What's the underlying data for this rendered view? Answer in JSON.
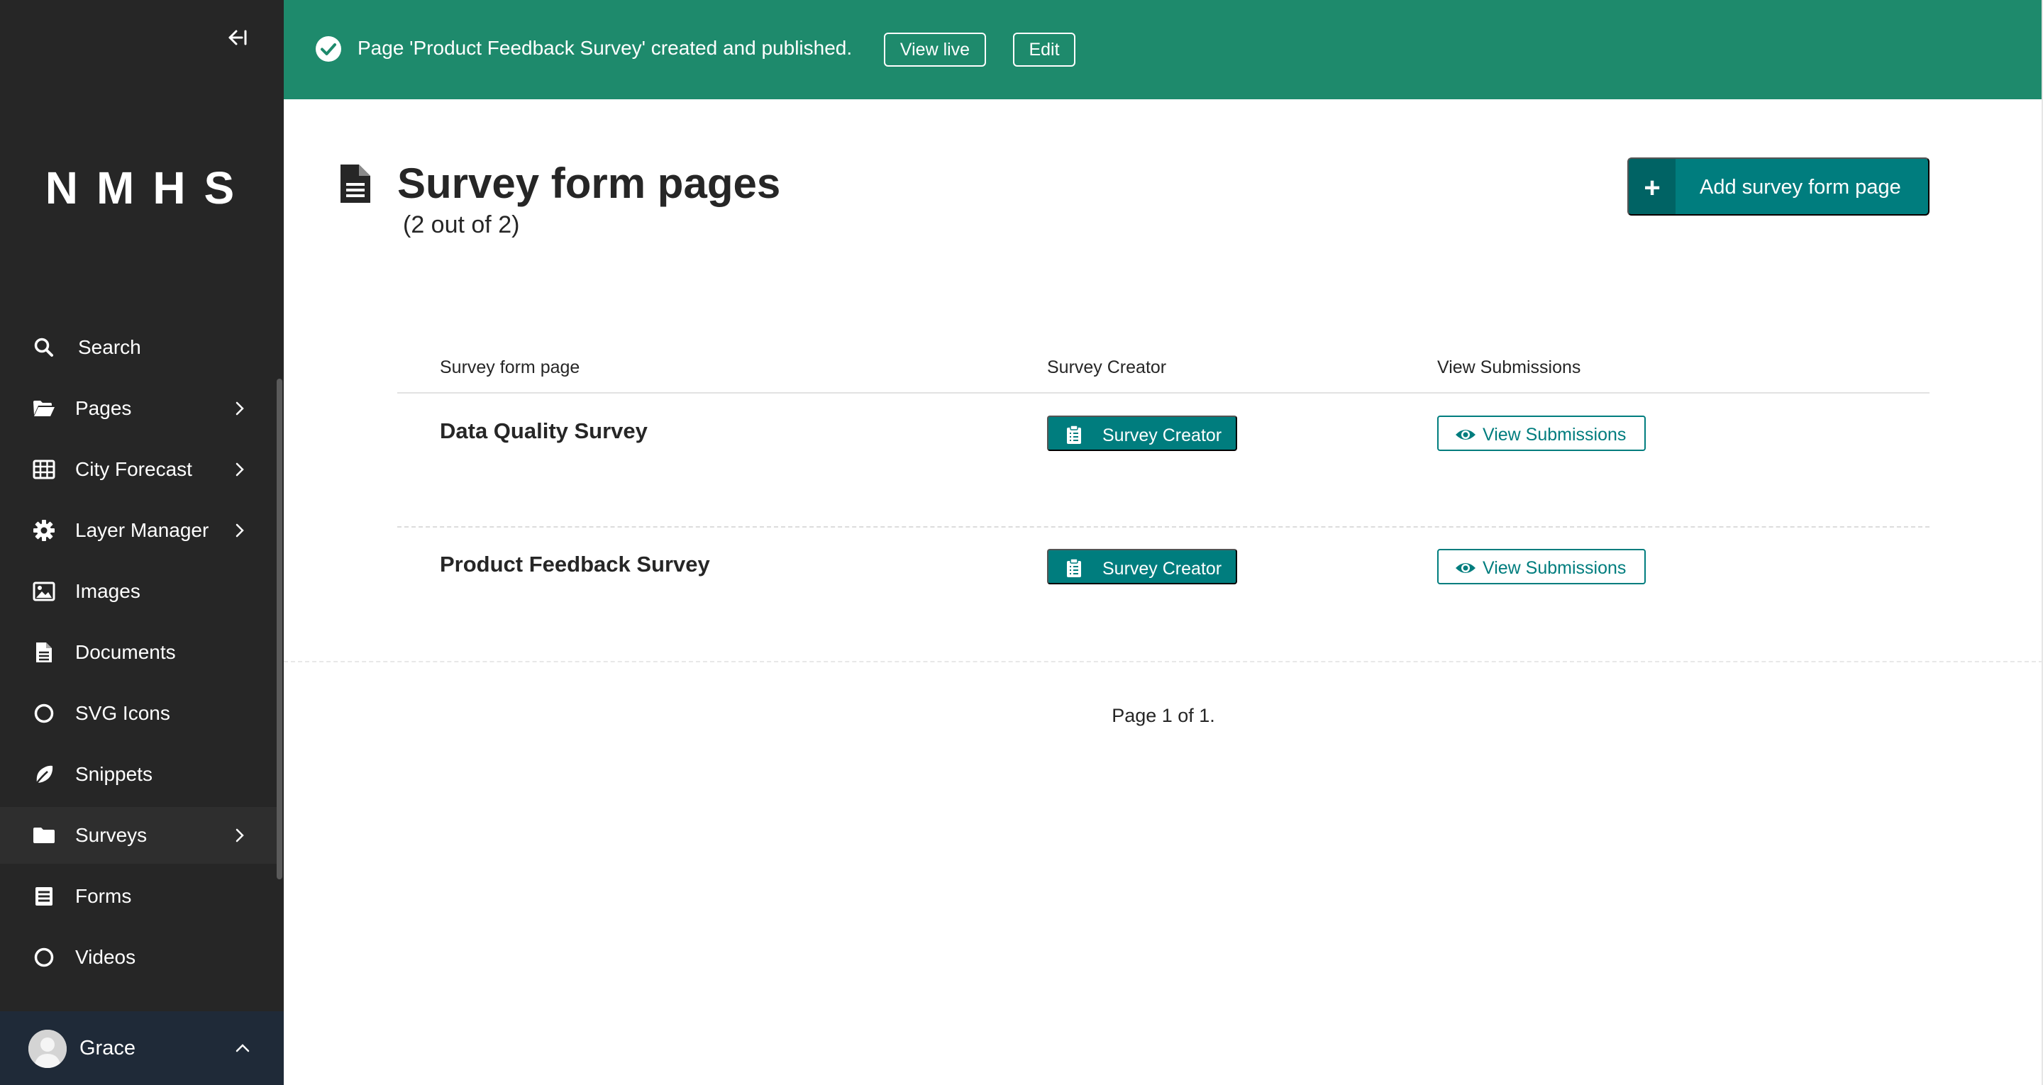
{
  "sidebar": {
    "logo": "NMHS",
    "collapse_icon": "collapse-left-icon",
    "items": [
      {
        "label": "Search",
        "icon": "search-icon",
        "has_submenu": false
      },
      {
        "label": "Pages",
        "icon": "folder-open-icon",
        "has_submenu": true
      },
      {
        "label": "City Forecast",
        "icon": "table-icon",
        "has_submenu": true
      },
      {
        "label": "Layer Manager",
        "icon": "gear-icon",
        "has_submenu": true
      },
      {
        "label": "Images",
        "icon": "image-icon",
        "has_submenu": false
      },
      {
        "label": "Documents",
        "icon": "document-icon",
        "has_submenu": false
      },
      {
        "label": "SVG Icons",
        "icon": "circle-icon",
        "has_submenu": false
      },
      {
        "label": "Snippets",
        "icon": "leaf-icon",
        "has_submenu": false
      },
      {
        "label": "Surveys",
        "icon": "folder-icon",
        "has_submenu": true,
        "active": true
      },
      {
        "label": "Forms",
        "icon": "form-icon",
        "has_submenu": false
      },
      {
        "label": "Videos",
        "icon": "circle-icon",
        "has_submenu": false
      }
    ],
    "account": {
      "name": "Grace"
    }
  },
  "banner": {
    "message": "Page 'Product Feedback Survey' created and published.",
    "view_live_label": "View live",
    "edit_label": "Edit",
    "color": "#1e8a6c"
  },
  "header": {
    "title": "Survey form pages",
    "count": "(2 out of 2)",
    "add_button_label": "Add survey form page"
  },
  "table": {
    "columns": [
      "Survey form page",
      "Survey Creator",
      "View Submissions"
    ],
    "rows": [
      {
        "title": "Data Quality Survey",
        "creator_label": "Survey Creator",
        "submissions_label": "View Submissions"
      },
      {
        "title": "Product Feedback Survey",
        "creator_label": "Survey Creator",
        "submissions_label": "View Submissions"
      }
    ]
  },
  "pagination": {
    "text": "Page 1 of 1."
  },
  "colors": {
    "accent": "#007d7e",
    "sidebar_bg": "#262626",
    "success": "#1e8a6c"
  }
}
